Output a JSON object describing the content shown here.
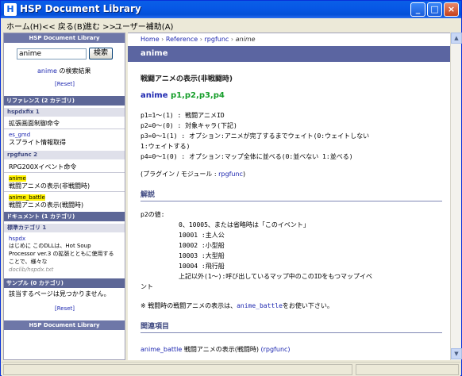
{
  "window": {
    "title": "HSP Document Library"
  },
  "menu": [
    "ホーム(H)",
    "<< 戻る(B)",
    "進む >>",
    "ユーザー補助(A)"
  ],
  "sidebar": {
    "header": "HSP Document Library",
    "search_value": "anime",
    "search_button": "検索",
    "result_keyword": "anime",
    "result_suffix": "の検索結果",
    "reset": "[Reset]",
    "ref_section": "リファレンス (2 カテゴリ)",
    "hspdxfix_sub": "hspdxfix 1",
    "hspdxfix_desc": "拡張画面制御命令",
    "es_gmd_link": "es_gmd",
    "es_gmd_desc": "スプライト情報取得",
    "rpgfunc_sub": "rpgfunc 2",
    "rpgfunc_desc": "RPG200Xイベント命令",
    "anime_link": "anime",
    "anime_desc": "戦闘アニメの表示(非戦闘時)",
    "anime_battle_link": "anime_battle",
    "anime_battle_desc": "戦闘アニメの表示(戦闘時)",
    "doc_section": "ドキュメント (1 カテゴリ)",
    "std_sub": "標準カテゴリ 1",
    "hspdx_link": "hspdx",
    "doc_text_1": "はじめに このDLLは、Hot Soup",
    "doc_text_2": "Processor ver.3 の拡張とともに使用する",
    "doc_text_3": "ことで、様々な",
    "doc_path": "doclib/hspdx.txt",
    "sample_section": "サンプル (0 カテゴリ)",
    "sample_none": "該当するページは見つかりません。",
    "reset2": "[Reset]",
    "footer": "HSP Document Library"
  },
  "content": {
    "crumb_home": "Home",
    "crumb_ref": "Reference",
    "crumb_cat": "rpgfunc",
    "crumb_cur": "anime",
    "sep": " › ",
    "header": "anime",
    "title": "戦闘アニメの表示(非戦闘時)",
    "syntax_fn": "anime",
    "syntax_args": "p1,p2,p3,p4",
    "params": [
      "p1=1～(1)  : 戦闘アニメID",
      "p2=0～(0)  : 対象キャラ(下記)",
      "p3=0～1(1) : オプション:アニメが完了するまでウェイト(0:ウェイトしない",
      "1:ウェイトする)",
      "p4=0～1(0) : オプション:マップ全体に並べる(0:並べない  1:並べる)"
    ],
    "plugin_prefix": "(プラグイン / モジュール : ",
    "plugin_name": "rpgfunc",
    "plugin_suffix": ")",
    "desc_heading": "解説",
    "desc_lines": [
      "p2の値:",
      "0、10005、または省略時は「このイベント」",
      "10001          :主人公",
      "10002          :小型船",
      "10003          :大型船",
      "10004          :飛行船",
      "上記以外(1～):呼び出しているマップ中のこのIDをもつマップイベ",
      "ント"
    ],
    "note_prefix": "※ 戦闘時の戦闘アニメの表示は、",
    "note_code": "anime_battle",
    "note_suffix": "をお使い下さい。",
    "related_heading": "関連項目",
    "related_link": "anime_battle",
    "related_desc": " 戦闘アニメの表示(戦闘時) ",
    "related_cat": "(rpgfunc)"
  }
}
